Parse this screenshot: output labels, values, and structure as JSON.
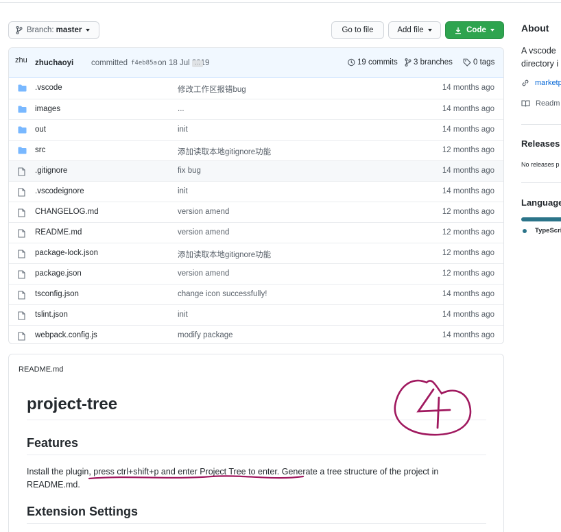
{
  "branch_button": {
    "label": "Branch:",
    "value": "master"
  },
  "goto_button": "Go to file",
  "add_button": "Add file",
  "code_button": "Code",
  "commit": {
    "avatar": "zhu",
    "author": "zhuchaoyi",
    "action": "committed",
    "sha": "f4eb85a",
    "date": "on 18 Jul 2019",
    "ellipsis": "…",
    "commits": "19 commits",
    "branches": "3 branches",
    "tags": "0 tags"
  },
  "files": [
    {
      "name": ".vscode",
      "type": "folder",
      "message": "修改工作区报错bug",
      "age": "14 months ago"
    },
    {
      "name": "images",
      "type": "folder",
      "message": "...",
      "age": "14 months ago"
    },
    {
      "name": "out",
      "type": "folder",
      "message": "init",
      "age": "14 months ago"
    },
    {
      "name": "src",
      "type": "folder",
      "message": "添加读取本地gitignore功能",
      "age": "12 months ago"
    },
    {
      "name": ".gitignore",
      "type": "file",
      "message": "fix bug",
      "age": "14 months ago"
    },
    {
      "name": ".vscodeignore",
      "type": "file",
      "message": "init",
      "age": "14 months ago"
    },
    {
      "name": "CHANGELOG.md",
      "type": "file",
      "message": "version amend",
      "age": "12 months ago"
    },
    {
      "name": "README.md",
      "type": "file",
      "message": "version amend",
      "age": "12 months ago"
    },
    {
      "name": "package-lock.json",
      "type": "file",
      "message": "添加读取本地gitignore功能",
      "age": "12 months ago"
    },
    {
      "name": "package.json",
      "type": "file",
      "message": "version amend",
      "age": "12 months ago"
    },
    {
      "name": "tsconfig.json",
      "type": "file",
      "message": "change icon successfully!",
      "age": "14 months ago"
    },
    {
      "name": "tslint.json",
      "type": "file",
      "message": "init",
      "age": "14 months ago"
    },
    {
      "name": "webpack.config.js",
      "type": "file",
      "message": "modify package",
      "age": "14 months ago"
    }
  ],
  "readme": {
    "filename": "README.md",
    "title": "project-tree",
    "features_heading": "Features",
    "features_text": "Install the plugin, press ctrl+shift+p and enter Project Tree to enter. Generate a tree structure of the project in README.md.",
    "settings_heading": "Extension Settings"
  },
  "annotation": "4",
  "sidebar": {
    "about": "About",
    "description": "A vscode directory i",
    "link": "marketp",
    "readme": "Readm",
    "releases": "Releases",
    "no_releases": "No releases p",
    "languages": "Language",
    "language_item": "TypeScri"
  },
  "colors": {
    "accent": "#0366d6",
    "code_green": "#2ea44f",
    "folder_blue": "#79b8ff",
    "annotation": "#a0195f",
    "typescript": "#2b7489"
  }
}
